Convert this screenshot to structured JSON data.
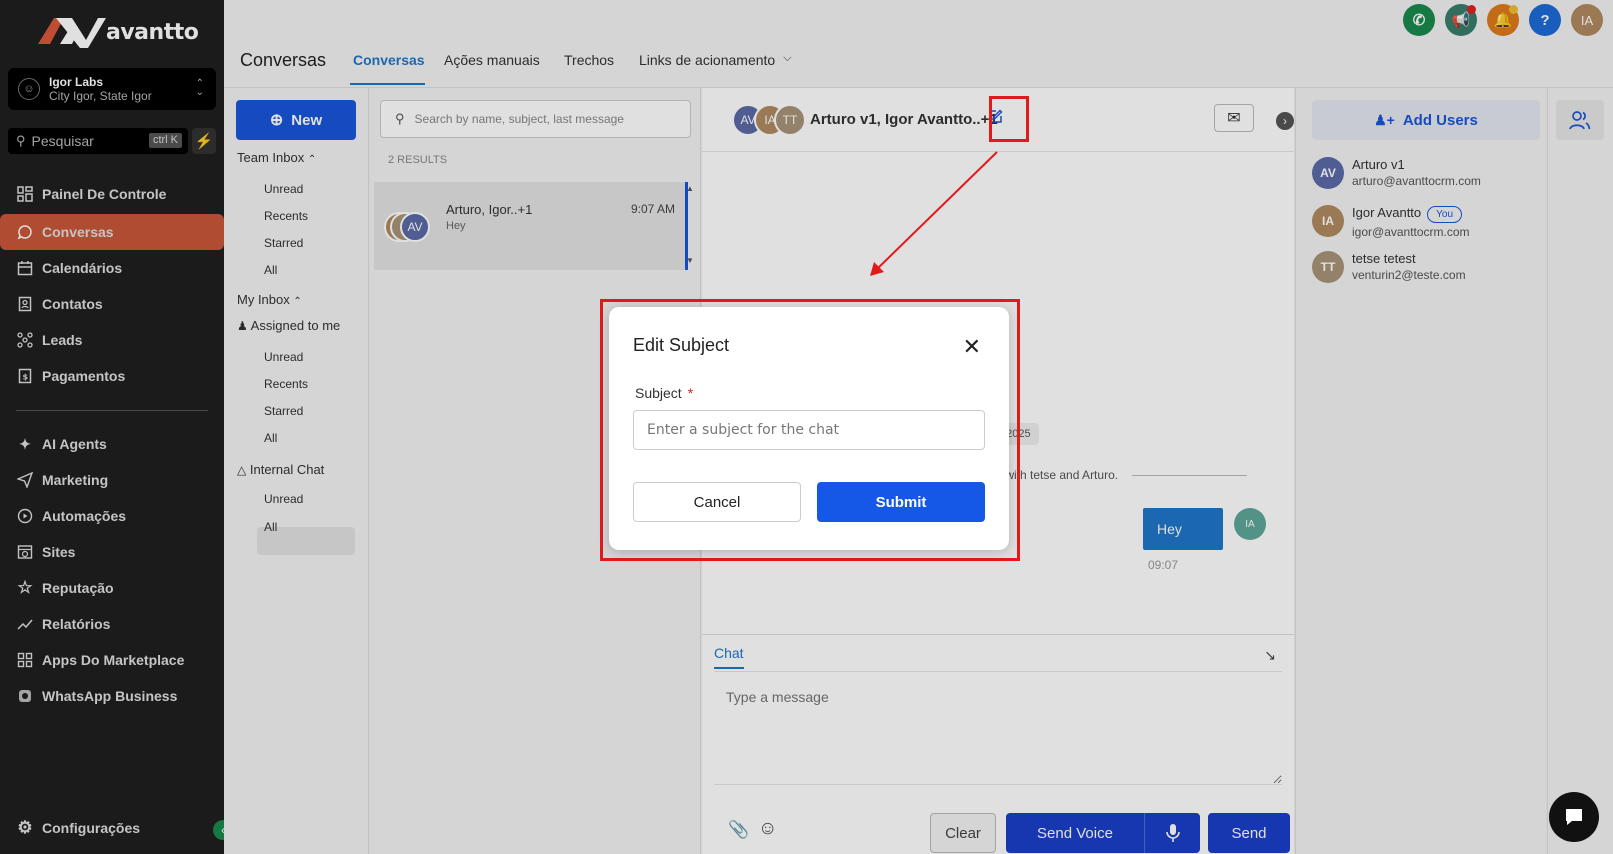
{
  "app": {
    "brand": "avantto"
  },
  "account": {
    "name": "Igor Labs",
    "location": "City Igor, State Igor"
  },
  "search": {
    "label": "Pesquisar",
    "shortcut": "ctrl K"
  },
  "nav": [
    {
      "label": "Painel De Controle",
      "icon": "dashboard-icon"
    },
    {
      "label": "Conversas",
      "icon": "chat-icon"
    },
    {
      "label": "Calendários",
      "icon": "calendar-icon"
    },
    {
      "label": "Contatos",
      "icon": "contacts-icon"
    },
    {
      "label": "Leads",
      "icon": "leads-icon"
    },
    {
      "label": "Pagamentos",
      "icon": "payments-icon"
    },
    {
      "label": "AI Agents",
      "icon": "sparkle-icon"
    },
    {
      "label": "Marketing",
      "icon": "send-icon"
    },
    {
      "label": "Automações",
      "icon": "play-icon"
    },
    {
      "label": "Sites",
      "icon": "globe-icon"
    },
    {
      "label": "Reputação",
      "icon": "star-icon"
    },
    {
      "label": "Relatórios",
      "icon": "chart-icon"
    },
    {
      "label": "Apps Do Marketplace",
      "icon": "grid-icon"
    },
    {
      "label": "WhatsApp Business",
      "icon": "whatsapp-icon"
    }
  ],
  "settings_label": "Configurações",
  "header": {
    "title": "Conversas",
    "tabs": [
      "Conversas",
      "Ações manuais",
      "Trechos",
      "Links de acionamento"
    ],
    "user_initials": "IA"
  },
  "inbox": {
    "new_label": "New",
    "team_inbox": "Team Inbox",
    "team_items": [
      "Unread",
      "Recents",
      "Starred",
      "All"
    ],
    "my_inbox": "My Inbox",
    "assigned": "Assigned to me",
    "my_items": [
      "Unread",
      "Recents",
      "Starred",
      "All"
    ],
    "internal_chat": "Internal Chat",
    "internal_items": [
      "Unread",
      "All"
    ]
  },
  "conversations": {
    "search_placeholder": "Search by name, subject, last message",
    "results": "2 RESULTS",
    "items": [
      {
        "name": "Arturo, Igor..+1",
        "preview": "Hey",
        "time": "9:07 AM",
        "avatar": "AV"
      }
    ]
  },
  "chat": {
    "title": "Arturo v1, Igor Avantto..+1",
    "avatars": [
      "AV",
      "IA",
      "TT"
    ],
    "date_chip": ", 2025",
    "system_msg": "at with tetse and Arturo.",
    "message": {
      "text": "Hey",
      "time": "09:07",
      "avatar": "IA"
    },
    "composer_tab": "Chat",
    "composer_placeholder": "Type a message",
    "clear_label": "Clear",
    "send_voice_label": "Send Voice",
    "send_label": "Send"
  },
  "users": {
    "add_label": "Add Users",
    "list": [
      {
        "initials": "AV",
        "name": "Arturo v1",
        "email": "arturo@avanttocrm.com",
        "color": "#5b6aa8"
      },
      {
        "initials": "IA",
        "name": "Igor Avantto",
        "email": "igor@avanttocrm.com",
        "color": "#b08a60",
        "badge": "You"
      },
      {
        "initials": "TT",
        "name": "tetse tetest",
        "email": "venturin2@teste.com",
        "color": "#a89478"
      }
    ]
  },
  "modal": {
    "title": "Edit Subject",
    "field_label": "Subject",
    "required_mark": "*",
    "placeholder": "Enter a subject for the chat",
    "cancel": "Cancel",
    "submit": "Submit"
  },
  "colors": {
    "accent": "#1a56db",
    "nav_active": "#c9573a",
    "highlight": "#e21a1a"
  }
}
